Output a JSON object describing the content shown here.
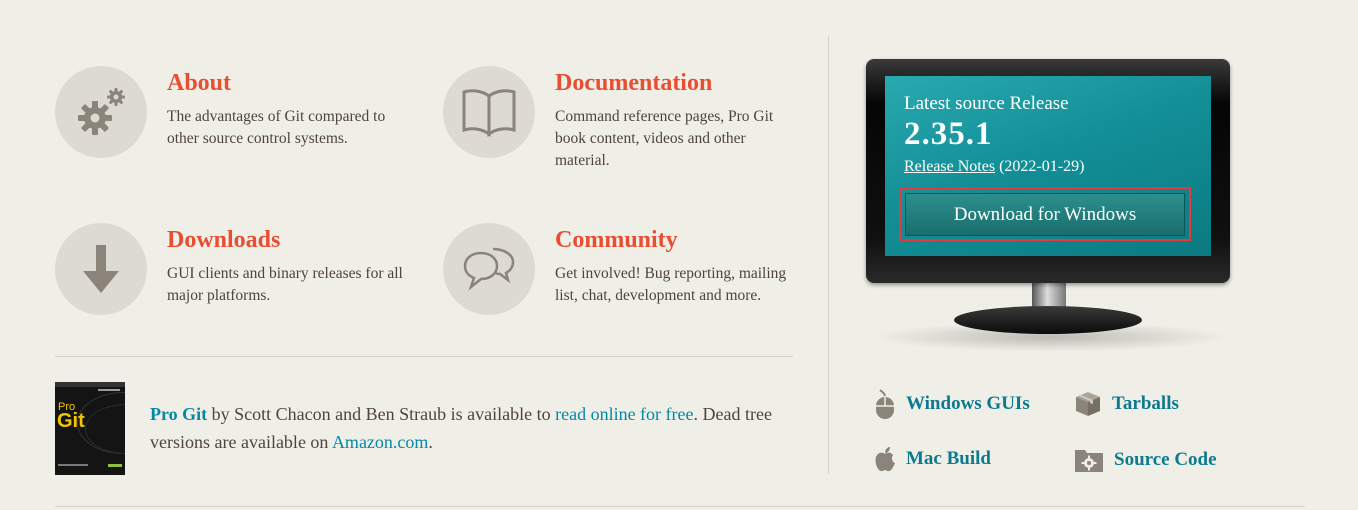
{
  "features": [
    {
      "title": "About",
      "description": "The advantages of Git compared to other source control systems.",
      "icon": "gears-icon"
    },
    {
      "title": "Documentation",
      "description": "Command reference pages, Pro Git book content, videos and other material.",
      "icon": "book-icon"
    },
    {
      "title": "Downloads",
      "description": "GUI clients and binary releases for all major platforms.",
      "icon": "download-arrow-icon"
    },
    {
      "title": "Community",
      "description": "Get involved! Bug reporting, mailing list, chat, development and more.",
      "icon": "speech-bubbles-icon"
    }
  ],
  "progit": {
    "book_cover_text": "Pro Git",
    "title_link": "Pro Git",
    "text1": " by Scott Chacon and Ben Straub is available to ",
    "read_link": "read online for free",
    "text2": ". Dead tree versions are available on ",
    "amazon_link": "Amazon.com",
    "text3": "."
  },
  "release": {
    "label": "Latest source Release",
    "version": "2.35.1",
    "notes_link": "Release Notes",
    "date": "(2022-01-29)",
    "download_button": "Download for Windows"
  },
  "download_links": [
    {
      "label": "Windows GUIs",
      "icon": "mouse-icon"
    },
    {
      "label": "Tarballs",
      "icon": "box-icon"
    },
    {
      "label": "Mac Build",
      "icon": "apple-icon"
    },
    {
      "label": "Source Code",
      "icon": "gear-folder-icon"
    }
  ],
  "colors": {
    "accent": "#e84e31",
    "link": "#0388a6",
    "background": "#f0efe7",
    "screen": "#138f97",
    "highlight": "#e23b3b"
  }
}
